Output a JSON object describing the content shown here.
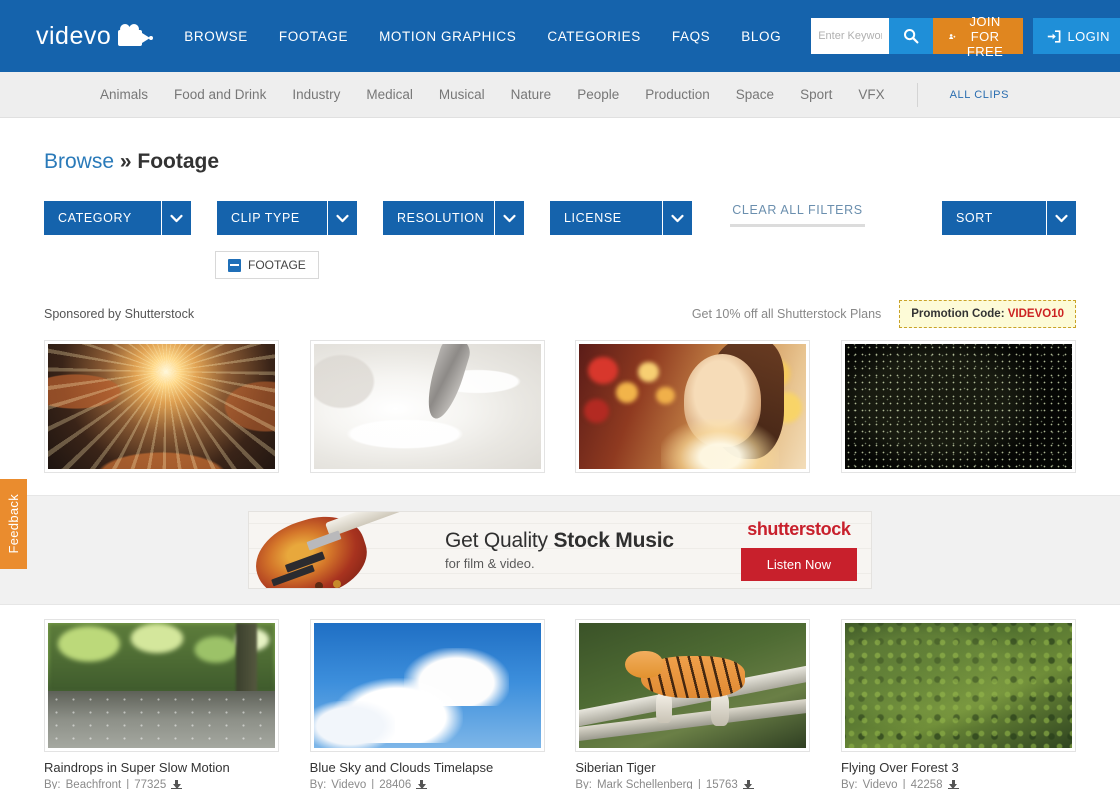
{
  "header": {
    "logo_text": "videvo",
    "nav": [
      {
        "label": "BROWSE"
      },
      {
        "label": "FOOTAGE"
      },
      {
        "label": "MOTION GRAPHICS"
      },
      {
        "label": "CATEGORIES"
      },
      {
        "label": "FAQS"
      },
      {
        "label": "BLOG"
      }
    ],
    "search": {
      "value": "",
      "placeholder": "Enter Keyword(s)"
    },
    "join_label": "JOIN FOR FREE",
    "login_label": "LOGIN",
    "brand_blue": "#1563ac",
    "accent_orange": "#e0861f",
    "accent_light_blue": "#1f8fd8"
  },
  "subnav": {
    "items": [
      {
        "label": "Animals"
      },
      {
        "label": "Food and Drink"
      },
      {
        "label": "Industry"
      },
      {
        "label": "Medical"
      },
      {
        "label": "Musical"
      },
      {
        "label": "Nature"
      },
      {
        "label": "People"
      },
      {
        "label": "Production"
      },
      {
        "label": "Space"
      },
      {
        "label": "Sport"
      },
      {
        "label": "VFX"
      }
    ],
    "all_clips_label": "ALL CLIPS"
  },
  "breadcrumb": {
    "parent": "Browse",
    "separator": "»",
    "current": "Footage"
  },
  "filters": {
    "category_label": "CATEGORY",
    "clip_type_label": "CLIP TYPE",
    "resolution_label": "RESOLUTION",
    "license_label": "LICENSE",
    "clear_all_label": "CLEAR ALL FILTERS",
    "sort_label": "SORT",
    "active_chips": [
      {
        "label": "FOOTAGE"
      }
    ]
  },
  "sponsored": {
    "label": "Sponsored by Shutterstock",
    "offer": "Get 10% off all Shutterstock Plans",
    "promo_prefix": "Promotion Code:",
    "promo_code": "VIDEVO10",
    "thumbs": [
      {
        "alt": "sunburst-through-branches"
      },
      {
        "alt": "white-cream-swirl-with-spoon"
      },
      {
        "alt": "woman-with-glowing-lights-bokeh"
      },
      {
        "alt": "dark-starfield-particles"
      }
    ]
  },
  "ad": {
    "headline_normal": "Get Quality ",
    "headline_bold": "Stock Music",
    "subline": "for film & video.",
    "brand": "shutterstock",
    "cta_label": "Listen Now"
  },
  "results": [
    {
      "title": "Raindrops in Super Slow Motion",
      "by_prefix": "By:",
      "author": "Beachfront",
      "sep": "|",
      "downloads": "77325"
    },
    {
      "title": "Blue Sky and Clouds Timelapse",
      "by_prefix": "By:",
      "author": "Videvo",
      "sep": "|",
      "downloads": "28406"
    },
    {
      "title": "Siberian Tiger",
      "by_prefix": "By:",
      "author": "Mark Schellenberg",
      "sep": "|",
      "downloads": "15763"
    },
    {
      "title": "Flying Over Forest 3",
      "by_prefix": "By:",
      "author": "Videvo",
      "sep": "|",
      "downloads": "42258"
    }
  ],
  "feedback": {
    "label": "Feedback"
  },
  "icons": {
    "search": "search-icon",
    "user_add": "user-add-icon",
    "login": "login-arrow-icon",
    "chevron": "chevron-down-icon",
    "remove_chip": "minus-square-icon",
    "download": "download-icon"
  }
}
